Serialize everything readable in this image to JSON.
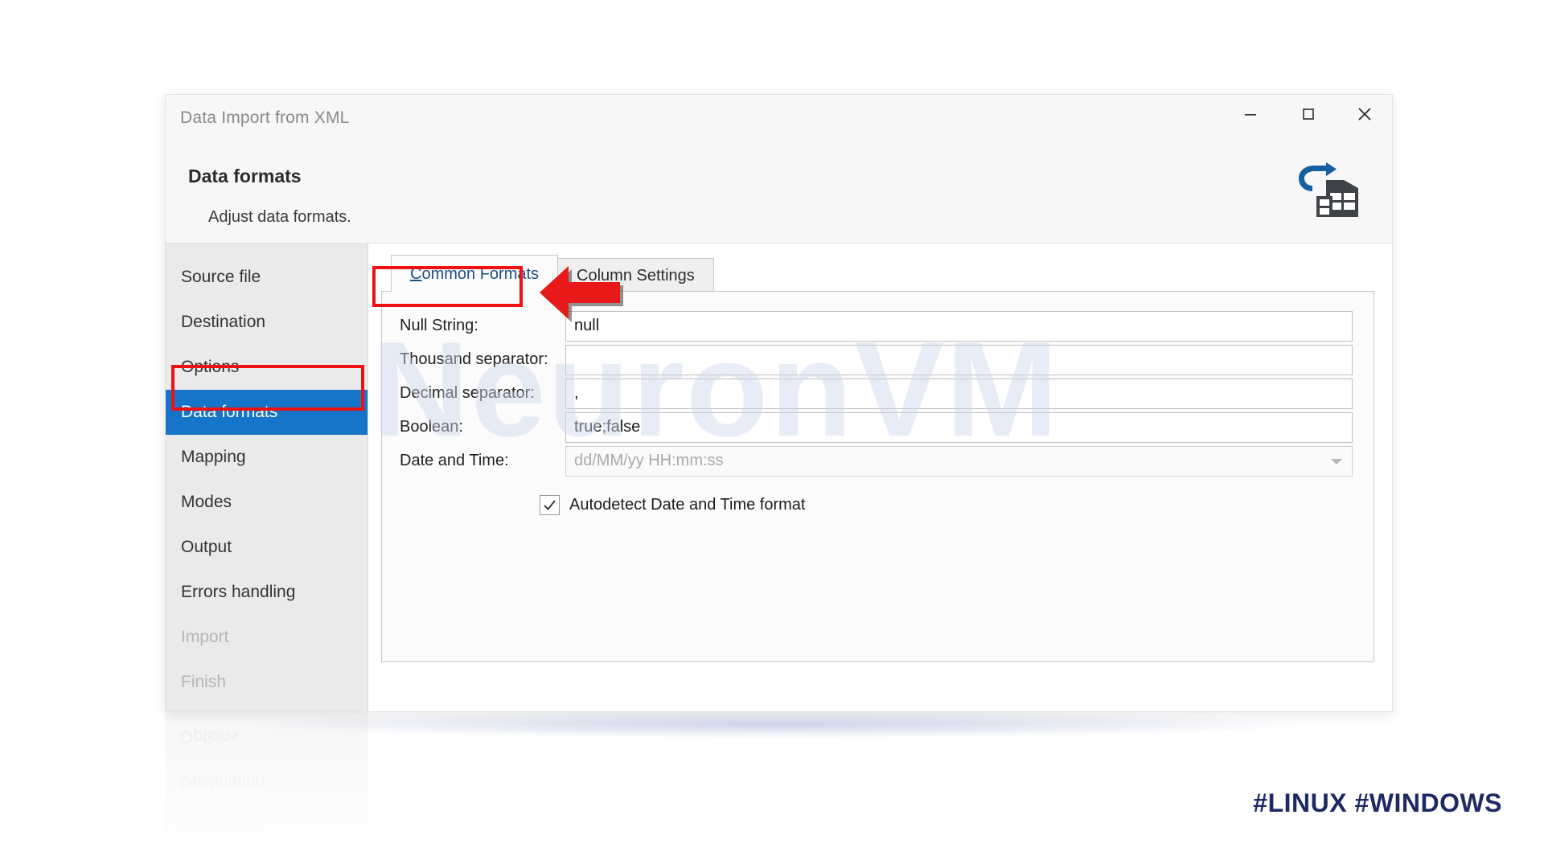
{
  "window": {
    "title": "Data Import from XML",
    "controls": {
      "minimize": "minimize-button",
      "maximize": "maximize-button",
      "close": "close-button"
    }
  },
  "header": {
    "title": "Data formats",
    "subtitle": "Adjust data formats.",
    "logo": "import-to-table-icon"
  },
  "sidebar": {
    "items": [
      {
        "label": "Source file",
        "state": "enabled"
      },
      {
        "label": "Destination",
        "state": "enabled"
      },
      {
        "label": "Options",
        "state": "enabled"
      },
      {
        "label": "Data formats",
        "state": "active"
      },
      {
        "label": "Mapping",
        "state": "enabled"
      },
      {
        "label": "Modes",
        "state": "enabled"
      },
      {
        "label": "Output",
        "state": "enabled"
      },
      {
        "label": "Errors handling",
        "state": "enabled"
      },
      {
        "label": "Import",
        "state": "disabled"
      },
      {
        "label": "Finish",
        "state": "disabled"
      }
    ]
  },
  "tabs": [
    {
      "label": "Common Formats",
      "accel": "C",
      "rest": "ommon Formats",
      "active": true
    },
    {
      "label": "Column Settings",
      "accel": "",
      "rest": "Column Settings",
      "active": false
    }
  ],
  "form": {
    "fields": [
      {
        "label": "Null String:",
        "value": "null",
        "placeholder": "",
        "readonly": false,
        "dropdown": false
      },
      {
        "label": "Thousand separator:",
        "value": "",
        "placeholder": "",
        "readonly": false,
        "dropdown": false
      },
      {
        "label": "Decimal separator:",
        "value": ",",
        "placeholder": "",
        "readonly": false,
        "dropdown": false
      },
      {
        "label": "Boolean:",
        "value": "true;false",
        "placeholder": "",
        "readonly": false,
        "dropdown": false
      },
      {
        "label": "Date and Time:",
        "value": "dd/MM/yy HH:mm:ss",
        "placeholder": "dd/MM/yy HH:mm:ss",
        "readonly": true,
        "dropdown": true
      }
    ],
    "checkbox": {
      "label": "Autodetect Date and Time format",
      "checked": true,
      "mark": "✓"
    }
  },
  "annotations": {
    "highlight_color": "#ee1111",
    "arrow": "left-pointing-arrow",
    "sidebar_highlight_target": "Data formats",
    "tab_highlight_target": "Common Formats"
  },
  "watermark": {
    "text": "NeuronVM",
    "color": "#cdd6ec"
  },
  "footer": {
    "hashtags": "#LINUX #WINDOWS",
    "color": "#1e2a63"
  }
}
